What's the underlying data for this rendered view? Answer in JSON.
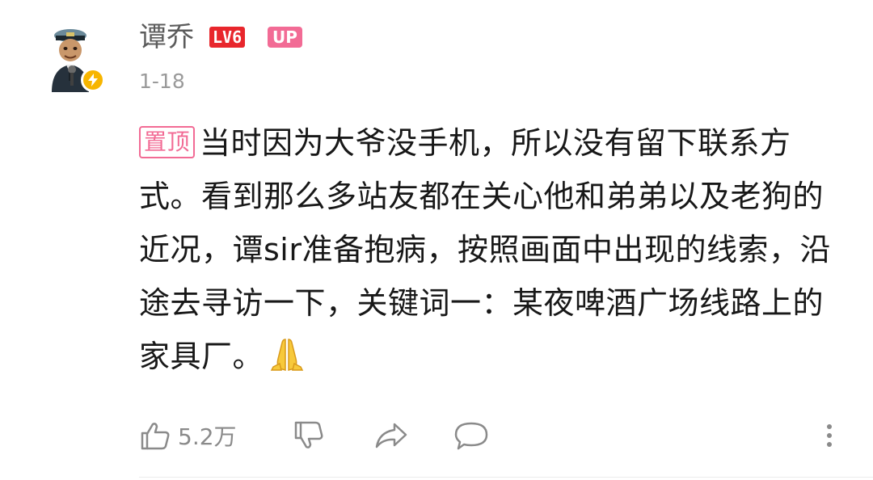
{
  "comment": {
    "author": {
      "name": "谭乔",
      "level": "LV6",
      "up_badge": "UP",
      "avatar_icon": "police-officer-avatar",
      "verified_icon": "lightning-bolt-icon"
    },
    "timestamp": "1-18",
    "pin_label": "置顶",
    "text": "当时因为大爷没手机，所以没有留下联系方式。看到那么多站友都在关心他和弟弟以及老狗的近况，谭sir准备抱病，按照画面中出现的线索，沿途去寻访一下，关键词一：某夜啤酒广场线路上的家具厂。",
    "emoji": "folded-hands",
    "actions": {
      "like_count": "5.2万",
      "like_icon": "thumbs-up-icon",
      "dislike_icon": "thumbs-down-icon",
      "share_icon": "share-icon",
      "reply_icon": "comment-bubble-icon",
      "more_icon": "more-vertical-icon"
    }
  },
  "colors": {
    "level_badge": "#e8262c",
    "up_badge": "#f26b95",
    "pin_tag": "#f26b95",
    "verified": "#f7b500",
    "text_primary": "#181818",
    "text_secondary": "#9a9a9a"
  }
}
